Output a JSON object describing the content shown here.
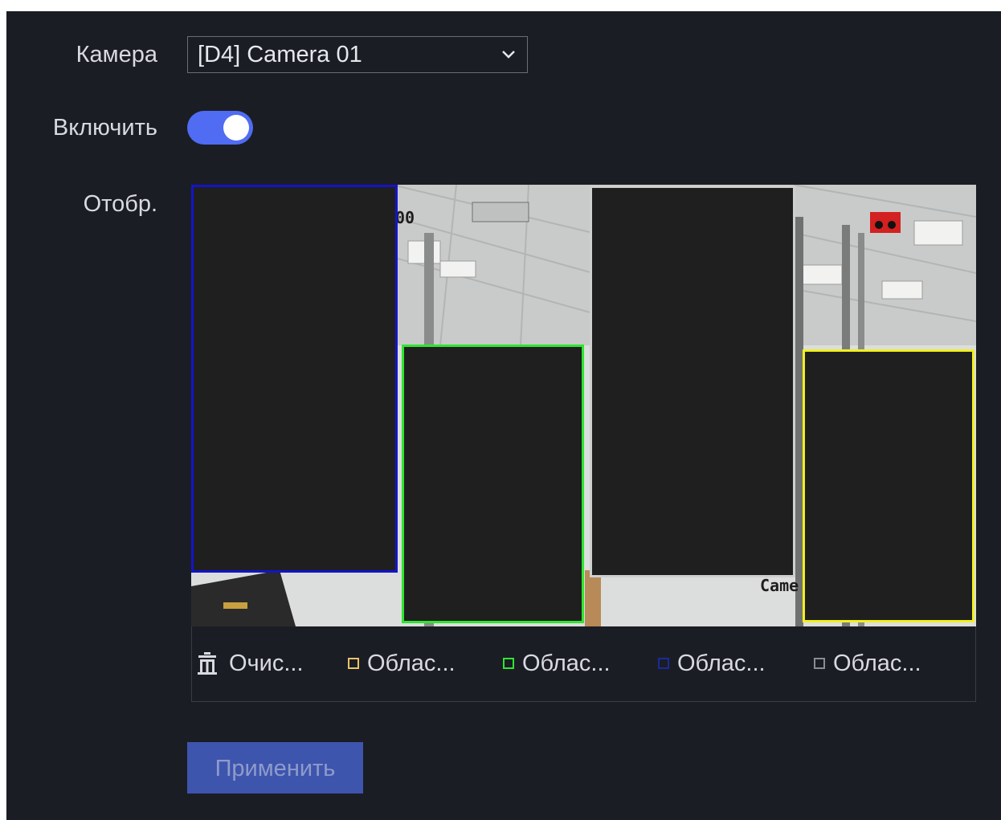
{
  "form": {
    "camera_label": "Камера",
    "camera_value": "[D4] Camera 01",
    "enable_label": "Включить",
    "enable_on": true,
    "display_label": "Отобр."
  },
  "video": {
    "overlay_text_top": "00",
    "overlay_text_bottom": "Came",
    "masks": [
      {
        "name": "mask-area-blue",
        "color": "#1414c8"
      },
      {
        "name": "mask-area-green",
        "color": "#2ee62e"
      },
      {
        "name": "mask-area-white",
        "color": "#cfcfcf"
      },
      {
        "name": "mask-area-yellow",
        "color": "#f0f020"
      }
    ]
  },
  "toolbar": {
    "clear_label": "Очис...",
    "area1_label": "Облас...",
    "area2_label": "Облас...",
    "area3_label": "Облас...",
    "area4_label": "Облас...",
    "area1_color": "#e8c36a",
    "area2_color": "#2ee62e",
    "area3_color": "#1a2a9a",
    "area4_color": "#8a8c92"
  },
  "apply_label": "Применить"
}
